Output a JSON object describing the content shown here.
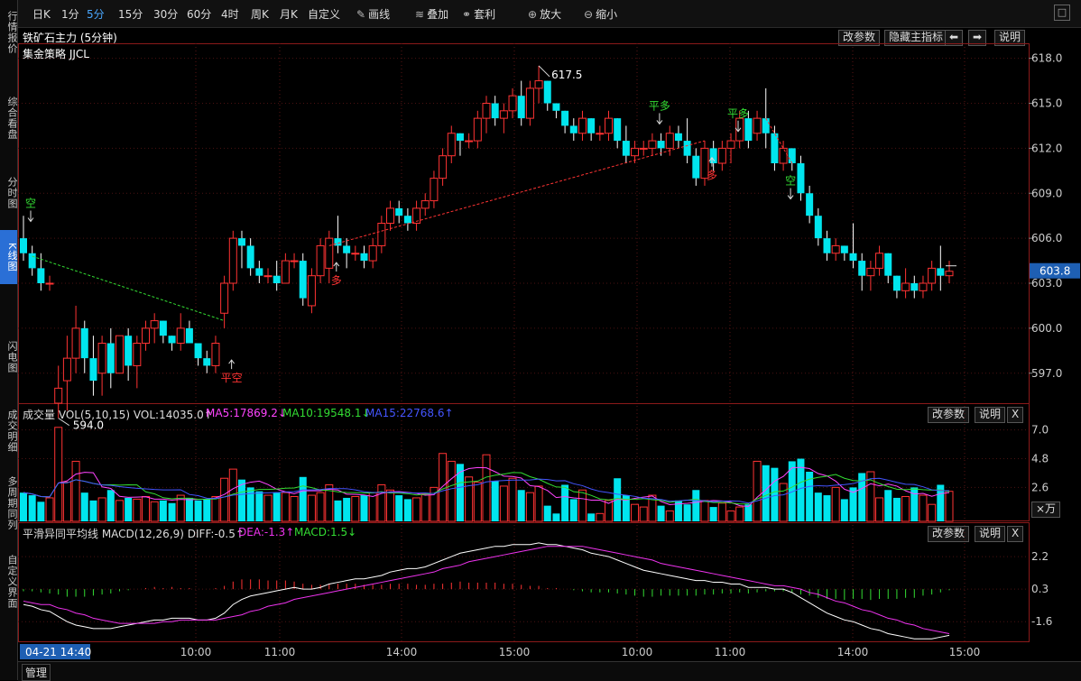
{
  "sidebar": {
    "tabs": [
      {
        "label": "行情报价",
        "active": false
      },
      {
        "label": "综合看盘",
        "active": false
      },
      {
        "label": "分时图",
        "active": false
      },
      {
        "label": "K线图",
        "active": true
      },
      {
        "label": "闪电图",
        "active": false
      },
      {
        "label": "成交明细",
        "active": false
      },
      {
        "label": "多周期同列",
        "active": false
      },
      {
        "label": "自定义界面",
        "active": false
      }
    ]
  },
  "toolbar": {
    "periods": [
      "日K",
      "1分",
      "5分",
      "15分",
      "30分",
      "60分",
      "4时",
      "周K",
      "月K",
      "自定义"
    ],
    "active_period": "5分",
    "tools": [
      {
        "label": "画线",
        "icon": "pencil-icon",
        "glyph": "✎"
      },
      {
        "label": "叠加",
        "icon": "stack-icon",
        "glyph": "≋"
      },
      {
        "label": "套利",
        "icon": "arbitrage-icon",
        "glyph": "⚭"
      },
      {
        "label": "放大",
        "icon": "zoom-in-icon",
        "glyph": "⊕"
      },
      {
        "label": "缩小",
        "icon": "zoom-out-icon",
        "glyph": "⊖"
      }
    ],
    "window_button": "□"
  },
  "main_panel": {
    "title": "铁矿石主力 (5分钟)",
    "strategy": "集金策略 JJCL",
    "buttons": {
      "params": "改参数",
      "hide_main": "隐藏主指标",
      "left": "⬅",
      "right": "➡",
      "help": "说明"
    },
    "current_price": "603.8",
    "high_label": "617.5",
    "low_label": "594.0",
    "y_ticks": [
      "618.0",
      "615.0",
      "612.0",
      "609.0",
      "606.0",
      "603.0",
      "600.0",
      "597.0"
    ],
    "signals": [
      {
        "text": "空",
        "color": "#33dd33"
      },
      {
        "text": "平空",
        "color": "#ff3333"
      },
      {
        "text": "多",
        "color": "#ff3333"
      },
      {
        "text": "平多",
        "color": "#33dd33"
      },
      {
        "text": "多",
        "color": "#ff3333"
      },
      {
        "text": "平多",
        "color": "#33dd33"
      },
      {
        "text": "空",
        "color": "#33dd33"
      }
    ]
  },
  "volume_panel": {
    "label": "成交量 VOL(5,10,15) VOL:14035.0↑",
    "ma5": "MA5:17869.2↓",
    "ma10": "MA10:19548.1↓",
    "ma15": "MA15:22768.6↑",
    "y_ticks": [
      "7.0",
      "4.8",
      "2.6"
    ],
    "unit_badge": "⨯万",
    "buttons": {
      "params": "改参数",
      "help": "说明",
      "close": "X"
    }
  },
  "macd_panel": {
    "label": "平滑异同平均线 MACD(12,26,9) DIFF:-0.5↑",
    "dea": "DEA:-1.3↑",
    "macd": "MACD:1.5↓",
    "y_ticks": [
      "2.2",
      "0.3",
      "-1.6"
    ],
    "buttons": {
      "params": "改参数",
      "help": "说明",
      "close": "X"
    }
  },
  "x_axis": {
    "cursor_label": "04-21 14:40",
    "ticks": [
      "10:00",
      "11:00",
      "14:00",
      "15:00",
      "10:00",
      "11:00",
      "14:00",
      "15:00"
    ]
  },
  "bottom": {
    "manage": "管理"
  },
  "colors": {
    "up": "#ff3333",
    "down": "#00e5ee",
    "diff": "#ffffff",
    "dea": "#ee33ee",
    "ma5": "#ff44ff",
    "ma10": "#33dd33",
    "ma15": "#4455ff"
  },
  "chart_data": {
    "type": "candlestick",
    "ylim": [
      595.0,
      619.0
    ],
    "candles": [
      [
        606.0,
        607.5,
        604.5,
        605.0
      ],
      [
        605.0,
        605.5,
        603.5,
        604.0
      ],
      [
        604.0,
        605.0,
        602.5,
        603.0
      ],
      [
        603.0,
        603.5,
        602.5,
        603.0
      ],
      [
        595.0,
        597.5,
        594.0,
        596.0
      ],
      [
        596.5,
        599.5,
        594.5,
        598.0
      ],
      [
        598.0,
        601.5,
        597.0,
        600.0
      ],
      [
        600.0,
        600.5,
        597.0,
        598.0
      ],
      [
        598.0,
        599.5,
        595.5,
        596.5
      ],
      [
        597.0,
        599.5,
        595.5,
        599.0
      ],
      [
        599.0,
        600.0,
        596.0,
        597.0
      ],
      [
        597.0,
        599.5,
        597.0,
        599.5
      ],
      [
        599.5,
        600.0,
        596.5,
        597.5
      ],
      [
        597.5,
        599.5,
        596.0,
        599.0
      ],
      [
        599.0,
        600.5,
        598.5,
        600.0
      ],
      [
        600.0,
        601.0,
        599.0,
        600.5
      ],
      [
        600.5,
        600.5,
        599.0,
        599.5
      ],
      [
        599.5,
        599.5,
        598.5,
        599.0
      ],
      [
        599.0,
        601.0,
        598.5,
        600.0
      ],
      [
        600.0,
        600.5,
        599.0,
        599.0
      ],
      [
        599.0,
        599.0,
        597.5,
        598.0
      ],
      [
        598.0,
        598.5,
        597.0,
        597.5
      ],
      [
        597.5,
        599.5,
        597.0,
        599.0
      ],
      [
        601.0,
        603.5,
        600.0,
        603.0
      ],
      [
        603.0,
        606.5,
        602.5,
        606.0
      ],
      [
        606.0,
        606.5,
        604.0,
        605.5
      ],
      [
        605.5,
        606.0,
        603.5,
        604.0
      ],
      [
        604.0,
        604.5,
        603.0,
        603.5
      ],
      [
        603.5,
        604.0,
        603.0,
        603.5
      ],
      [
        603.5,
        604.5,
        602.5,
        603.0
      ],
      [
        603.0,
        605.0,
        603.0,
        604.5
      ],
      [
        604.5,
        605.0,
        604.0,
        604.5
      ],
      [
        604.5,
        605.0,
        601.5,
        602.0
      ],
      [
        601.5,
        604.0,
        601.0,
        603.5
      ],
      [
        603.5,
        606.0,
        603.0,
        605.5
      ],
      [
        604.0,
        606.5,
        603.0,
        606.0
      ],
      [
        606.0,
        607.5,
        605.0,
        605.5
      ],
      [
        605.5,
        606.0,
        604.0,
        605.0
      ],
      [
        605.0,
        605.5,
        604.5,
        605.0
      ],
      [
        605.0,
        605.5,
        604.0,
        604.5
      ],
      [
        604.5,
        606.0,
        604.0,
        605.5
      ],
      [
        605.5,
        607.5,
        605.0,
        607.0
      ],
      [
        607.0,
        608.5,
        606.5,
        608.0
      ],
      [
        608.0,
        608.5,
        607.0,
        607.5
      ],
      [
        607.5,
        608.0,
        606.5,
        607.0
      ],
      [
        607.0,
        608.5,
        606.5,
        608.0
      ],
      [
        608.0,
        609.0,
        607.5,
        608.5
      ],
      [
        608.5,
        610.5,
        608.0,
        610.0
      ],
      [
        610.0,
        612.0,
        609.5,
        611.5
      ],
      [
        611.5,
        613.5,
        611.0,
        613.0
      ],
      [
        613.0,
        613.0,
        611.5,
        612.5
      ],
      [
        612.5,
        613.0,
        612.0,
        612.5
      ],
      [
        612.5,
        614.5,
        612.0,
        614.0
      ],
      [
        614.0,
        615.5,
        613.0,
        615.0
      ],
      [
        615.0,
        615.5,
        613.5,
        614.0
      ],
      [
        614.0,
        615.0,
        613.0,
        614.5
      ],
      [
        614.5,
        616.0,
        614.0,
        615.5
      ],
      [
        615.5,
        616.5,
        613.5,
        614.0
      ],
      [
        614.0,
        616.5,
        613.5,
        616.0
      ],
      [
        616.0,
        617.5,
        615.0,
        616.5
      ],
      [
        616.5,
        616.5,
        614.5,
        615.0
      ],
      [
        615.0,
        615.0,
        614.0,
        614.5
      ],
      [
        614.5,
        614.5,
        613.0,
        613.5
      ],
      [
        613.5,
        614.0,
        612.5,
        613.0
      ],
      [
        613.0,
        614.5,
        612.5,
        614.0
      ],
      [
        614.0,
        614.0,
        612.5,
        613.0
      ],
      [
        613.0,
        613.5,
        612.5,
        613.0
      ],
      [
        613.0,
        614.5,
        612.5,
        614.0
      ],
      [
        614.0,
        614.0,
        612.0,
        612.5
      ],
      [
        612.5,
        613.5,
        611.0,
        611.5
      ],
      [
        611.5,
        612.5,
        611.0,
        612.0
      ],
      [
        612.0,
        612.5,
        611.5,
        612.0
      ],
      [
        612.0,
        613.0,
        611.5,
        612.5
      ],
      [
        612.5,
        613.0,
        611.5,
        612.0
      ],
      [
        612.0,
        613.5,
        611.5,
        613.0
      ],
      [
        613.0,
        613.5,
        612.0,
        612.5
      ],
      [
        612.5,
        614.0,
        611.0,
        611.5
      ],
      [
        611.5,
        612.0,
        609.5,
        610.0
      ],
      [
        610.0,
        612.5,
        609.5,
        612.0
      ],
      [
        612.0,
        612.5,
        610.5,
        611.0
      ],
      [
        611.0,
        612.5,
        610.5,
        612.0
      ],
      [
        612.0,
        613.0,
        611.0,
        612.5
      ],
      [
        612.5,
        614.5,
        612.0,
        614.0
      ],
      [
        614.0,
        614.5,
        612.0,
        612.5
      ],
      [
        613.0,
        614.5,
        612.5,
        614.0
      ],
      [
        614.0,
        616.0,
        612.0,
        613.0
      ],
      [
        613.0,
        613.5,
        610.5,
        611.0
      ],
      [
        611.0,
        612.5,
        610.5,
        612.0
      ],
      [
        612.0,
        612.0,
        610.5,
        611.0
      ],
      [
        611.0,
        611.5,
        608.5,
        609.0
      ],
      [
        609.0,
        609.5,
        607.0,
        607.5
      ],
      [
        607.5,
        608.0,
        605.5,
        606.0
      ],
      [
        606.0,
        606.5,
        604.5,
        605.0
      ],
      [
        605.0,
        606.0,
        604.5,
        605.5
      ],
      [
        605.5,
        605.5,
        604.5,
        605.0
      ],
      [
        605.0,
        607.0,
        604.0,
        604.5
      ],
      [
        604.5,
        605.0,
        602.5,
        603.5
      ],
      [
        603.5,
        604.5,
        602.5,
        604.0
      ],
      [
        604.0,
        605.5,
        603.5,
        605.0
      ],
      [
        605.0,
        605.0,
        603.0,
        603.5
      ],
      [
        603.5,
        603.5,
        602.0,
        602.5
      ],
      [
        602.5,
        604.0,
        602.0,
        603.0
      ],
      [
        603.0,
        603.5,
        602.0,
        602.5
      ],
      [
        602.5,
        603.5,
        602.0,
        603.0
      ],
      [
        603.0,
        604.5,
        602.5,
        604.0
      ],
      [
        604.0,
        605.5,
        602.5,
        603.5
      ],
      [
        603.5,
        604.5,
        603.0,
        603.8
      ]
    ],
    "volume": [
      2.2,
      2.0,
      1.5,
      1.8,
      7.2,
      3.0,
      4.6,
      2.2,
      1.6,
      1.8,
      2.4,
      1.6,
      1.8,
      1.7,
      1.9,
      1.5,
      1.6,
      1.4,
      2.0,
      1.8,
      1.6,
      1.7,
      1.9,
      3.3,
      4.0,
      3.2,
      2.6,
      2.3,
      2.0,
      2.2,
      2.2,
      1.9,
      3.4,
      2.0,
      2.2,
      2.8,
      1.6,
      1.8,
      1.9,
      2.0,
      2.2,
      2.8,
      2.4,
      2.0,
      1.7,
      1.8,
      2.1,
      2.6,
      5.2,
      4.6,
      4.4,
      3.4,
      3.0,
      5.1,
      3.1,
      2.7,
      3.3,
      2.4,
      2.2,
      2.7,
      1.2,
      0.6,
      2.8,
      1.7,
      2.4,
      0.6,
      0.6,
      1.6,
      3.3,
      2.0,
      1.3,
      1.1,
      2.0,
      1.2,
      0.8,
      1.6,
      1.3,
      2.4,
      1.6,
      1.1,
      1.4,
      0.8,
      1.1,
      1.3,
      4.6,
      4.3,
      4.1,
      2.9,
      4.6,
      4.8,
      3.8,
      2.2,
      2.0,
      2.6,
      1.7,
      2.6,
      3.7,
      3.8,
      1.8,
      2.4,
      1.8,
      1.9,
      2.6,
      2.0,
      1.3,
      2.8,
      2.3
    ],
    "dif": [
      -0.6,
      -0.7,
      -0.9,
      -1.0,
      -1.3,
      -1.6,
      -1.8,
      -1.9,
      -2.0,
      -2.0,
      -2.0,
      -1.9,
      -1.8,
      -1.7,
      -1.6,
      -1.5,
      -1.5,
      -1.4,
      -1.4,
      -1.4,
      -1.5,
      -1.5,
      -1.4,
      -1.1,
      -0.6,
      -0.3,
      -0.1,
      0.0,
      0.1,
      0.2,
      0.3,
      0.4,
      0.3,
      0.3,
      0.4,
      0.6,
      0.7,
      0.8,
      0.9,
      0.9,
      1.0,
      1.1,
      1.3,
      1.4,
      1.5,
      1.5,
      1.6,
      1.8,
      2.0,
      2.2,
      2.4,
      2.5,
      2.6,
      2.7,
      2.8,
      2.8,
      2.9,
      2.9,
      2.9,
      3.0,
      2.9,
      2.9,
      2.8,
      2.7,
      2.6,
      2.4,
      2.3,
      2.2,
      2.0,
      1.8,
      1.6,
      1.4,
      1.3,
      1.2,
      1.1,
      1.0,
      0.9,
      0.8,
      0.8,
      0.7,
      0.7,
      0.6,
      0.6,
      0.4,
      0.4,
      0.4,
      0.3,
      0.3,
      0.1,
      -0.2,
      -0.5,
      -0.8,
      -1.1,
      -1.3,
      -1.5,
      -1.6,
      -1.8,
      -2.0,
      -2.1,
      -2.3,
      -2.4,
      -2.5,
      -2.6,
      -2.6,
      -2.6,
      -2.5,
      -2.4
    ],
    "dea": [
      -0.4,
      -0.5,
      -0.6,
      -0.6,
      -0.8,
      -0.9,
      -1.1,
      -1.2,
      -1.4,
      -1.5,
      -1.6,
      -1.7,
      -1.7,
      -1.7,
      -1.7,
      -1.7,
      -1.6,
      -1.6,
      -1.5,
      -1.5,
      -1.5,
      -1.5,
      -1.5,
      -1.4,
      -1.3,
      -1.2,
      -1.0,
      -0.9,
      -0.7,
      -0.6,
      -0.5,
      -0.3,
      -0.2,
      -0.1,
      0.0,
      0.1,
      0.2,
      0.3,
      0.4,
      0.5,
      0.6,
      0.7,
      0.8,
      0.9,
      1.0,
      1.1,
      1.2,
      1.3,
      1.5,
      1.6,
      1.7,
      1.9,
      2.0,
      2.1,
      2.2,
      2.3,
      2.4,
      2.5,
      2.6,
      2.7,
      2.8,
      2.8,
      2.8,
      2.8,
      2.8,
      2.7,
      2.6,
      2.5,
      2.4,
      2.3,
      2.2,
      2.1,
      2.0,
      1.8,
      1.7,
      1.6,
      1.5,
      1.4,
      1.3,
      1.2,
      1.1,
      1.0,
      0.9,
      0.8,
      0.7,
      0.6,
      0.5,
      0.5,
      0.4,
      0.3,
      0.1,
      0.0,
      -0.2,
      -0.4,
      -0.5,
      -0.7,
      -0.9,
      -1.0,
      -1.2,
      -1.4,
      -1.5,
      -1.7,
      -1.8,
      -2.0,
      -2.1,
      -2.2,
      -2.3
    ]
  }
}
